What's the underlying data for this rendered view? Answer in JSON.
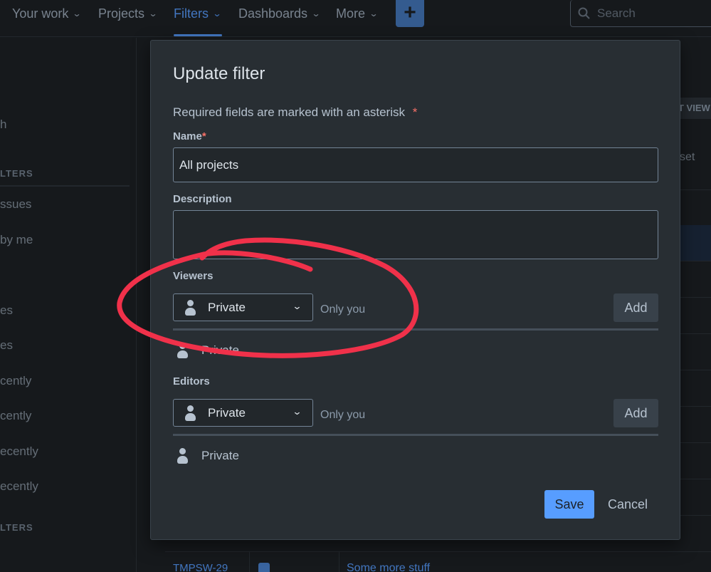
{
  "nav": {
    "items": [
      {
        "label": "Your work"
      },
      {
        "label": "Projects"
      },
      {
        "label": "Filters"
      },
      {
        "label": "Dashboards"
      },
      {
        "label": "More"
      }
    ],
    "create_label": "+",
    "search_placeholder": "Search"
  },
  "background": {
    "sidebar_fragments": [
      "h",
      "LTERS",
      "ssues",
      "by me",
      "es",
      "es",
      "cently",
      "cently",
      "ecently",
      "ecently",
      "LTERS"
    ],
    "view_button": "T VIEW",
    "right_fragment": "set",
    "bottom_row": {
      "id": "TMPSW-29",
      "summary": "Some more stuff"
    }
  },
  "dialog": {
    "title": "Update filter",
    "required_note": "Required fields are marked with an asterisk",
    "asterisk": "*",
    "name": {
      "label": "Name",
      "value": "All projects"
    },
    "description": {
      "label": "Description",
      "value": ""
    },
    "viewers": {
      "label": "Viewers",
      "select_value": "Private",
      "hint": "Only you",
      "add_label": "Add",
      "current": "Private"
    },
    "editors": {
      "label": "Editors",
      "select_value": "Private",
      "hint": "Only you",
      "add_label": "Add",
      "current": "Private"
    },
    "save_label": "Save",
    "cancel_label": "Cancel"
  },
  "colors": {
    "accent": "#579dff",
    "annotation": "#f0314a",
    "dialog_bg": "#282e33",
    "page_bg": "#1d2125"
  }
}
